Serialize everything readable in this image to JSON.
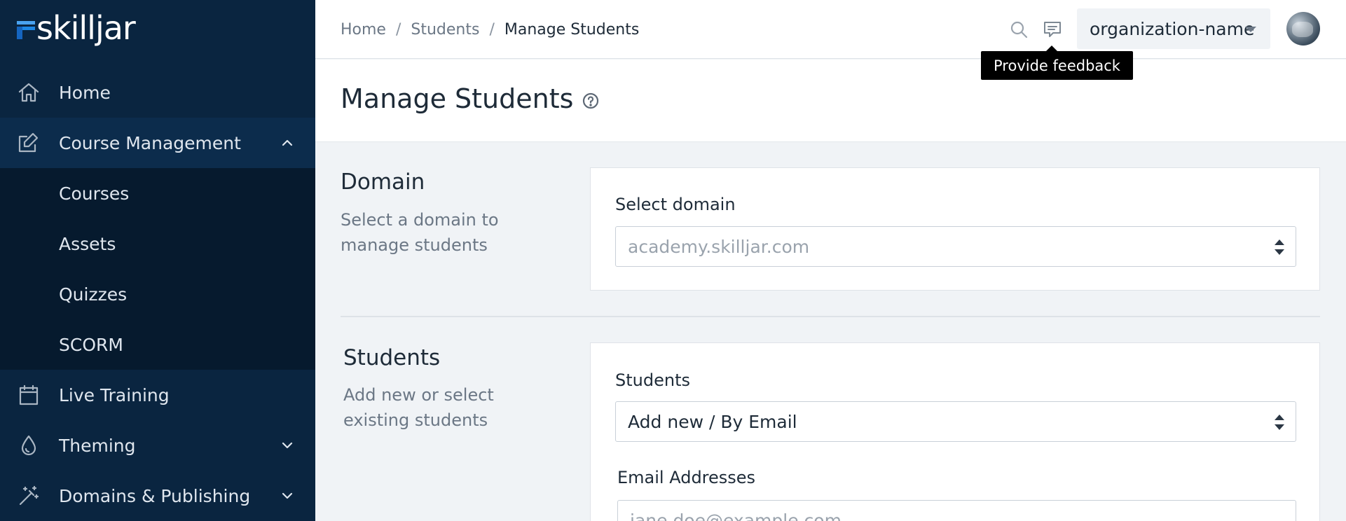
{
  "app": {
    "logo_text": "skilljar"
  },
  "sidebar": {
    "items": [
      {
        "label": "Home",
        "icon": "home-icon"
      },
      {
        "label": "Course Management",
        "icon": "edit-icon",
        "expanded": true
      },
      {
        "label": "Live Training",
        "icon": "calendar-icon"
      },
      {
        "label": "Theming",
        "icon": "droplet-icon"
      },
      {
        "label": "Domains & Publishing",
        "icon": "magic-wand-icon"
      }
    ],
    "subitems": [
      {
        "label": "Courses"
      },
      {
        "label": "Assets"
      },
      {
        "label": "Quizzes"
      },
      {
        "label": "SCORM"
      }
    ]
  },
  "topbar": {
    "breadcrumb": [
      "Home",
      "Students",
      "Manage Students"
    ],
    "breadcrumb_separator": "/",
    "org_name": "organization-name",
    "tooltip": "Provide feedback"
  },
  "page": {
    "title": "Manage Students"
  },
  "domain_section": {
    "title": "Domain",
    "description": "Select a domain to manage students",
    "field_label": "Select domain",
    "selected_value": "academy.skilljar.com"
  },
  "students_section": {
    "title": "Students",
    "description": "Add new or select existing students",
    "field_label": "Students",
    "selected_value": "Add new / By Email",
    "email_label": "Email Addresses",
    "email_placeholder": "jane.doe@example.com"
  },
  "colors": {
    "sidebar_bg": "#0a2540",
    "subnav_bg": "#061a2e",
    "expanded_bg": "#0c2c4c",
    "page_bg": "#f0f3f6",
    "accent": "#1e88e5"
  }
}
